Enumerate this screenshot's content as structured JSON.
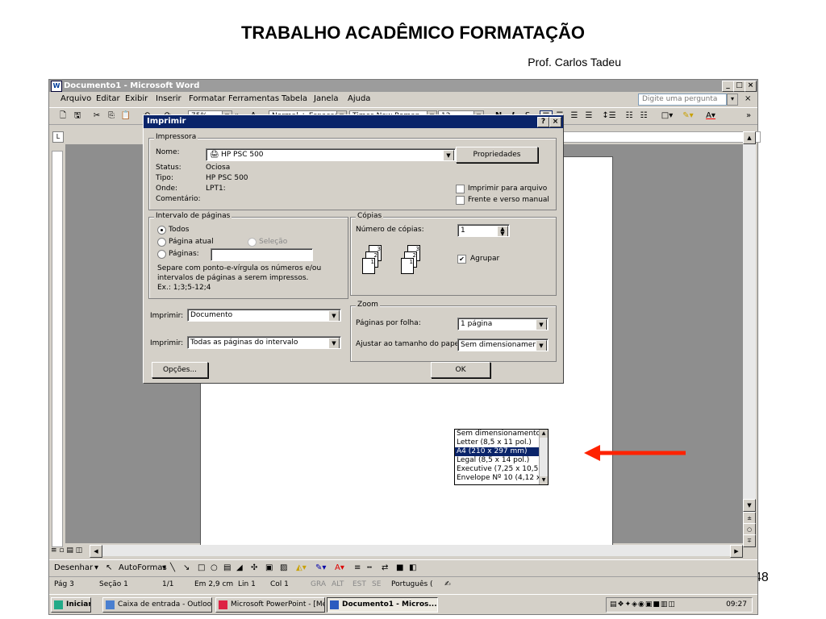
{
  "slide": {
    "title": "TRABALHO ACADÊMICO FORMATAÇÃO",
    "author": "Prof. Carlos Tadeu",
    "page_number": "48"
  },
  "window": {
    "title": "Documento1 - Microsoft Word",
    "min": "_",
    "max": "□",
    "close": "×"
  },
  "menu": {
    "items": [
      "Arquivo",
      "Editar",
      "Exibir",
      "Inserir",
      "Formatar",
      "Ferramentas",
      "Tabela",
      "Janela",
      "Ajuda"
    ],
    "help_placeholder": "Digite uma pergunta",
    "close": "×"
  },
  "toolbar": {
    "zoom": "75%",
    "style": "Normal + Espaçamei",
    "font": "Times New Roman",
    "size": "12",
    "bold": "N",
    "italic": "I",
    "underline": "S"
  },
  "ruler_text": "3 · 1 · 2 · 1 · 1 · 1 ·  · 1 · 1 · 1 · 2 · 1 · 3 · 1 · 4 · 1 · 5 · 1 · 6 · 1 · 7 · 1 · 8 · 1 · 9 · 1 ·10· 1 ·11· 1 ·12· 1 ·13· 1 ·14· 1 ·15· 1 ·  · 1 ·17· 1 ·",
  "dialog": {
    "title": "Imprimir",
    "help_btn": "?",
    "close_btn": "×",
    "printer": {
      "group": "Impressora",
      "name_label": "Nome:",
      "name_value": "HP PSC 500",
      "properties": "Propriedades",
      "status_label": "Status:",
      "status_value": "Ociosa",
      "type_label": "Tipo:",
      "type_value": "HP PSC 500",
      "where_label": "Onde:",
      "where_value": "LPT1:",
      "comment_label": "Comentário:",
      "print_to_file": "Imprimir para arquivo",
      "manual_duplex": "Frente e verso manual"
    },
    "range": {
      "group": "Intervalo de páginas",
      "all": "Todos",
      "current": "Página atual",
      "selection": "Seleção",
      "pages": "Páginas:",
      "hint1": "Separe com ponto-e-vírgula os números e/ou",
      "hint2": "intervalos de páginas a serem impressos.",
      "hint3": "Ex.: 1;3;5-12;4"
    },
    "copies": {
      "group": "Cópias",
      "number_label": "Número de cópias:",
      "number_value": "1",
      "collate": "Agrupar"
    },
    "print_what_label": "Imprimir:",
    "print_what_value": "Documento",
    "print_label": "Imprimir:",
    "print_value": "Todas as páginas do intervalo",
    "zoom": {
      "group": "Zoom",
      "pages_per_sheet_label": "Páginas por folha:",
      "pages_per_sheet_value": "1 página",
      "scale_label": "Ajustar ao tamanho do papel:",
      "scale_value": "Sem dimensionamento"
    },
    "options_btn": "Opções...",
    "ok_btn": "OK"
  },
  "paper_dropdown": {
    "items": [
      "Sem dimensionamento",
      "Letter (8,5 x 11 pol.)",
      "A4 (210 x 297 mm)",
      "Legal (8,5 x 14 pol.)",
      "Executive (7,25 x 10,5 p",
      "Envelope Nº 10 (4,12 x"
    ],
    "selected_index": 2
  },
  "drawing": {
    "draw": "Desenhar",
    "autoshapes": "AutoFormas"
  },
  "status": {
    "page": "Pág 3",
    "section": "Seção 1",
    "pages": "1/1",
    "at": "Em 2,9 cm",
    "line": "Lin 1",
    "col": "Col 1",
    "rec": "GRA",
    "trk": "ALT",
    "ext": "EST",
    "ovr": "SE",
    "language": "Português ("
  },
  "taskbar": {
    "start": "Iniciar",
    "tasks": [
      "Caixa de entrada - Outlook...",
      "Microsoft PowerPoint - [Me...",
      "Documento1 - Micros..."
    ],
    "clock": "09:27"
  },
  "colors": {
    "arrow": "#ff2200",
    "title_active": "#0a246a",
    "title_inactive": "#9c9c9c"
  }
}
